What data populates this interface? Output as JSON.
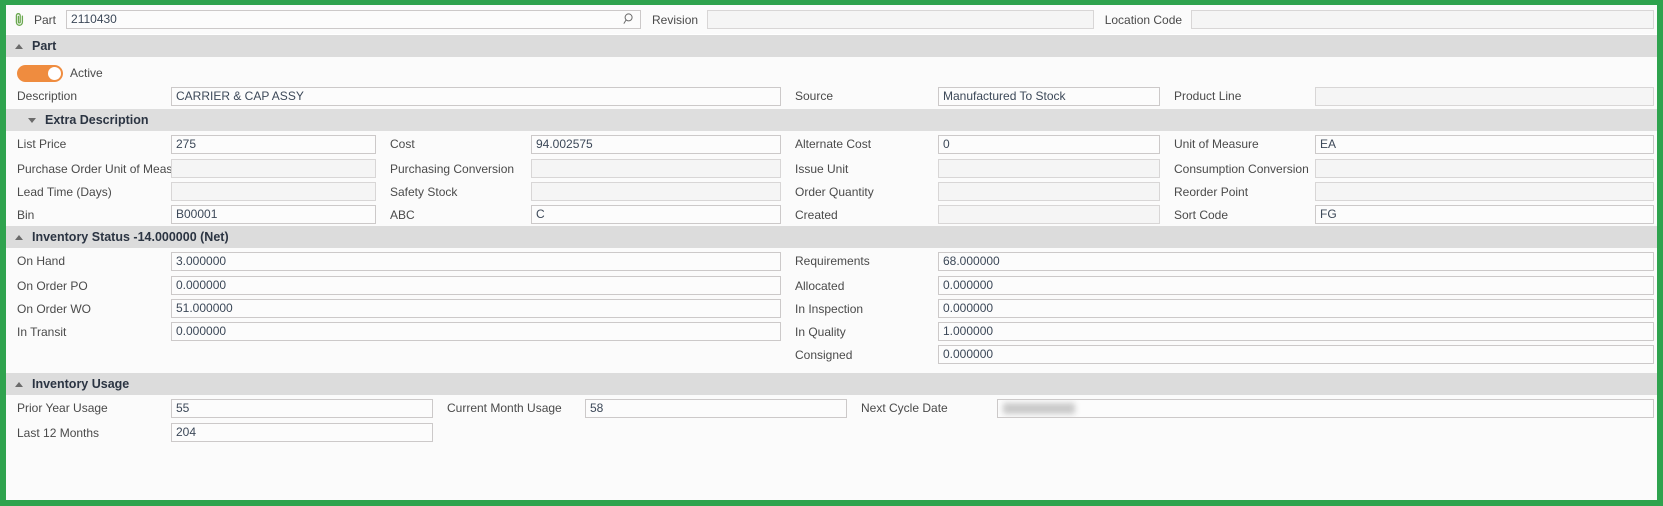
{
  "theme": {
    "frame": "#2fa34e",
    "toggle_on": "#ef8c3f",
    "header_bar": "#dcdcdc"
  },
  "keybar": {
    "part_label": "Part",
    "part_value": "2110430",
    "revision_label": "Revision",
    "revision_value": "",
    "location_code_label": "Location Code",
    "location_code_value": ""
  },
  "part_section": {
    "title": "Part",
    "active_label": "Active",
    "active_on": true,
    "description_label": "Description",
    "description_value": "CARRIER & CAP ASSY",
    "source_label": "Source",
    "source_value": "Manufactured To Stock",
    "product_line_label": "Product Line",
    "product_line_value": ""
  },
  "extra_description": {
    "title": "Extra Description",
    "rows": [
      {
        "l1": "List Price",
        "v1": "275",
        "l2": "Cost",
        "v2": "94.002575",
        "l3": "Alternate Cost",
        "v3": "0",
        "l4": "Unit of Measure",
        "v4": "EA"
      },
      {
        "l1": "Purchase Order Unit of Measure",
        "v1": "",
        "l2": "Purchasing Conversion",
        "v2": "",
        "l3": "Issue Unit",
        "v3": "",
        "l4": "Consumption Conversion",
        "v4": ""
      },
      {
        "l1": "Lead Time (Days)",
        "v1": "",
        "l2": "Safety Stock",
        "v2": "",
        "l3": "Order Quantity",
        "v3": "",
        "l4": "Reorder Point",
        "v4": ""
      },
      {
        "l1": "Bin",
        "v1": "B00001",
        "l2": "ABC",
        "v2": "C",
        "l3": "Created",
        "v3": "",
        "l4": "Sort Code",
        "v4": "FG"
      }
    ]
  },
  "inventory_status": {
    "title": "Inventory Status -14.000000 (Net)",
    "rows": [
      {
        "l1": "On Hand",
        "v1": "3.000000",
        "l2": "Requirements",
        "v2": "68.000000"
      },
      {
        "l1": "On Order PO",
        "v1": "0.000000",
        "l2": "Allocated",
        "v2": "0.000000"
      },
      {
        "l1": "On Order WO",
        "v1": "51.000000",
        "l2": "In Inspection",
        "v2": "0.000000"
      },
      {
        "l1": "In Transit",
        "v1": "0.000000",
        "l2": "In Quality",
        "v2": "1.000000"
      },
      {
        "l1": "",
        "v1": null,
        "l2": "Consigned",
        "v2": "0.000000"
      }
    ]
  },
  "inventory_usage": {
    "title": "Inventory Usage",
    "prior_year_label": "Prior Year Usage",
    "prior_year_value": "55",
    "current_month_label": "Current Month Usage",
    "current_month_value": "58",
    "next_cycle_label": "Next Cycle Date",
    "next_cycle_value": "",
    "last12_label": "Last 12 Months",
    "last12_value": "204"
  }
}
